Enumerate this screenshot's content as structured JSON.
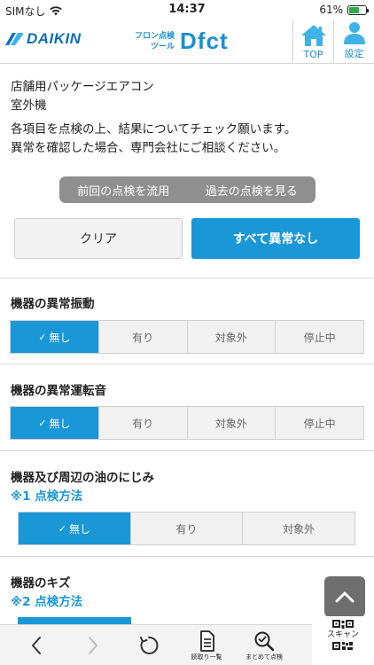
{
  "status_bar": {
    "carrier": "SIMなし",
    "time": "14:37",
    "battery_percent": "61%",
    "battery_level": 0.61
  },
  "header": {
    "brand": "DAIKIN",
    "app_sub_line1": "フロン点検",
    "app_sub_line2": "ツール",
    "app_name": "Dfct",
    "top_label": "TOP",
    "settings_label": "設定"
  },
  "intro": {
    "line1": "店舗用パッケージエアコン",
    "line2": "室外機",
    "line3": "各項目を点検の上、結果についてチェック願います。",
    "line4": "異常を確認した場合、専門会社にご相談ください。"
  },
  "history": {
    "reuse_label": "前回の点検を流用",
    "past_label": "過去の点検を見る"
  },
  "actions": {
    "clear_label": "クリア",
    "all_ok_label": "すべて異常なし"
  },
  "items": [
    {
      "title": "機器の異常振動",
      "options": [
        "無し",
        "有り",
        "対象外",
        "停止中"
      ],
      "selected": 0
    },
    {
      "title": "機器の異常運転音",
      "options": [
        "無し",
        "有り",
        "対象外",
        "停止中"
      ],
      "selected": 0
    },
    {
      "title": "機器及び周辺の油のにじみ",
      "link": "※1 点検方法",
      "options": [
        "無し",
        "有り",
        "対象外"
      ],
      "selected": 0
    },
    {
      "title": "機器のキズ",
      "link": "※2 点検方法"
    }
  ],
  "toolbar": {
    "list_label": "読取り一覧",
    "batch_label": "まとめて点検",
    "scan_label": "スキャン"
  },
  "colors": {
    "accent": "#1a97d6",
    "brand": "#0c6fb8",
    "battery": "#2ea94b"
  }
}
